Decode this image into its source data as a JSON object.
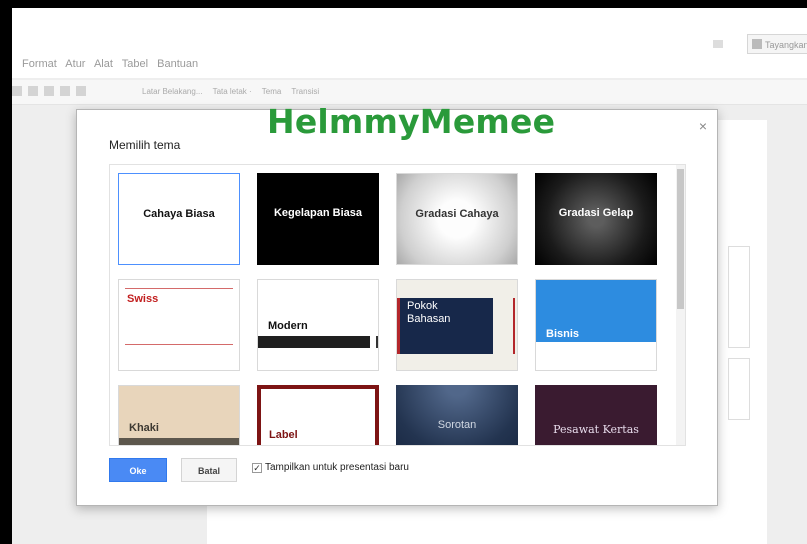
{
  "menubar": {
    "menus": [
      "Format",
      "Atur",
      "Alat",
      "Tabel",
      "Bantuan"
    ],
    "present_label": "Tayangkan"
  },
  "toolbar": {
    "labels": [
      "Latar Belakang...",
      "Tata letak ·",
      "Tema",
      "Transisi"
    ]
  },
  "dialog": {
    "title": "Memilih tema",
    "close_symbol": "×",
    "watermark": "HelmmyMemee",
    "themes": [
      {
        "label": "Cahaya Biasa"
      },
      {
        "label": "Kegelapan Biasa"
      },
      {
        "label": "Gradasi Cahaya"
      },
      {
        "label": "Gradasi Gelap"
      },
      {
        "label": "Swiss"
      },
      {
        "label": "Modern"
      },
      {
        "label": "Pokok Bahasan"
      },
      {
        "label": "Bisnis"
      },
      {
        "label": "Khaki"
      },
      {
        "label": "Label"
      },
      {
        "label": "Sorotan"
      },
      {
        "label": "Pesawat Kertas"
      }
    ],
    "selected_theme": "Cahaya Biasa",
    "ok_label": "Oke",
    "cancel_label": "Batal",
    "checkbox_checked": true,
    "checkbox_label": "Tampilkan untuk presentasi baru"
  },
  "colors": {
    "accent_blue": "#4a8af4",
    "watermark_green": "#2a9a3a"
  }
}
